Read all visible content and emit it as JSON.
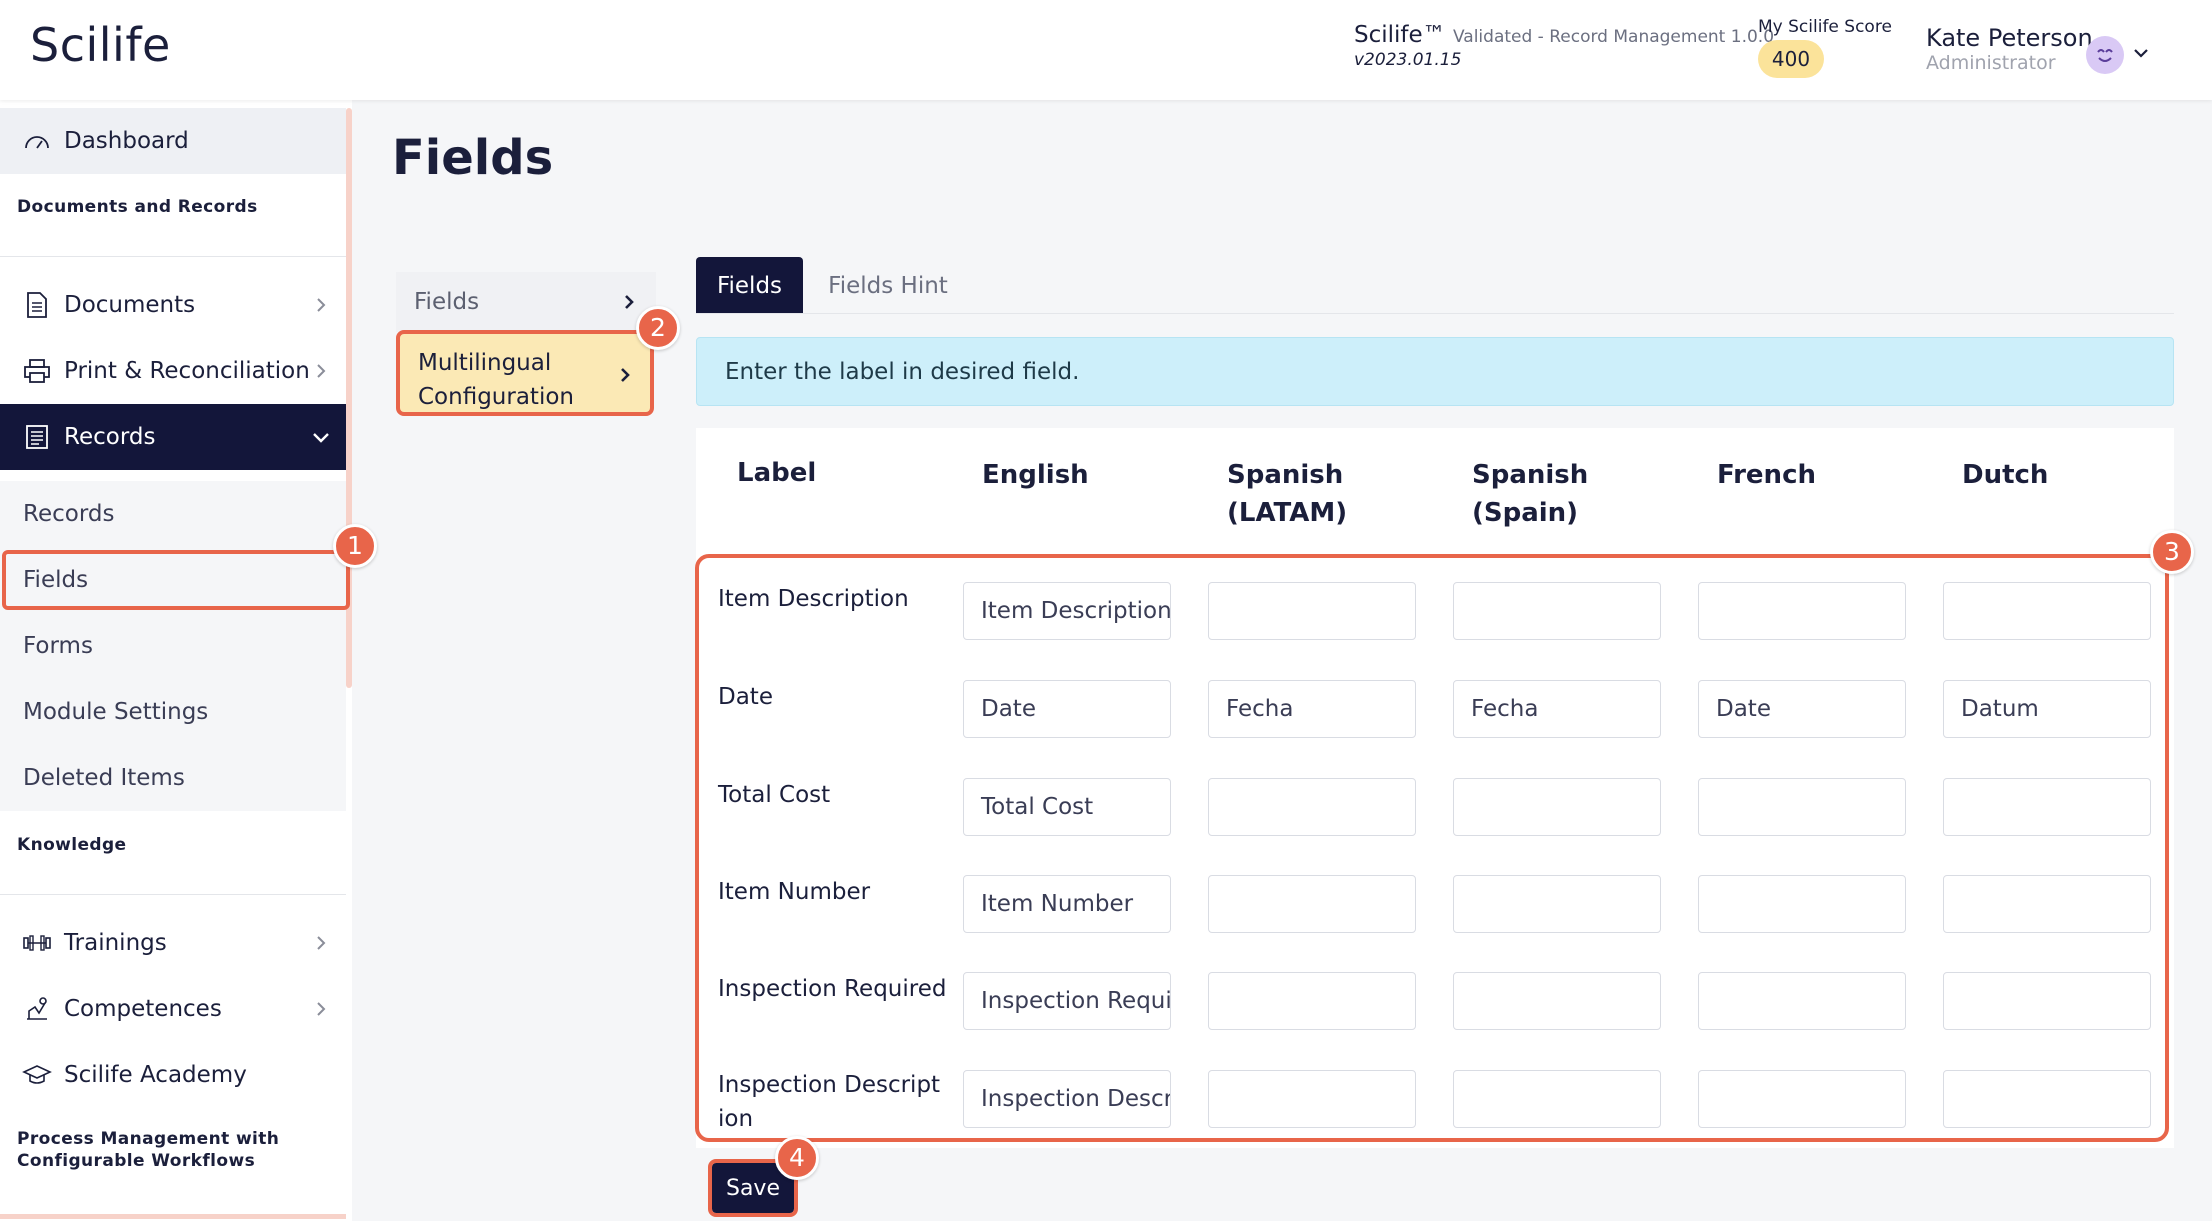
{
  "header": {
    "logo": "Scilife",
    "app_name": "Scilife™",
    "app_sub": "Validated - Record Management 1.0.0",
    "app_version": "v2023.01.15",
    "score_label": "My Scilife Score",
    "score_value": "400",
    "user_name": "Kate Peterson",
    "user_role": "Administrator"
  },
  "sidebar": {
    "dashboard": "Dashboard",
    "section_docs": "Documents and Records",
    "documents": "Documents",
    "print": "Print & Reconciliation",
    "records": "Records",
    "sub_items": [
      "Records",
      "Fields",
      "Forms",
      "Module Settings",
      "Deleted Items"
    ],
    "section_knowledge": "Knowledge",
    "trainings": "Trainings",
    "competences": "Competences",
    "academy": "Scilife Academy",
    "section_process_1": "Process Management with",
    "section_process_2": "Configurable Workflows"
  },
  "main": {
    "title": "Fields",
    "subnav": {
      "fields": "Fields",
      "multilingual_1": "Multilingual",
      "multilingual_2": "Configuration"
    },
    "tabs": {
      "fields": "Fields",
      "hint": "Fields Hint"
    },
    "info": "Enter the label in desired field.",
    "columns": {
      "label": "Label",
      "english": "English",
      "spanish_latam_1": "Spanish",
      "spanish_latam_2": "(LATAM)",
      "spanish_spain_1": "Spanish",
      "spanish_spain_2": "(Spain)",
      "french": "French",
      "dutch": "Dutch"
    },
    "rows": [
      {
        "label": "Item Description",
        "label2": "",
        "values": [
          "Item Description",
          "",
          "",
          "",
          ""
        ]
      },
      {
        "label": "Date",
        "label2": "",
        "values": [
          "Date",
          "Fecha",
          "Fecha",
          "Date",
          "Datum"
        ]
      },
      {
        "label": "Total Cost",
        "label2": "",
        "values": [
          "Total Cost",
          "",
          "",
          "",
          ""
        ]
      },
      {
        "label": "Item Number",
        "label2": "",
        "values": [
          "Item Number",
          "",
          "",
          "",
          ""
        ]
      },
      {
        "label": "Inspection Required",
        "label2": "",
        "values": [
          "Inspection Requi",
          "",
          "",
          "",
          ""
        ]
      },
      {
        "label": "Inspection Descript",
        "label2": "ion",
        "values": [
          "Inspection Descr",
          "",
          "",
          "",
          ""
        ]
      }
    ],
    "save": "Save"
  },
  "annotations": [
    "1",
    "2",
    "3",
    "4"
  ],
  "colors": {
    "accent": "#e8654a",
    "navy": "#13163a",
    "highlight": "#fbe9b5",
    "info_bg": "#cdeffa",
    "score_bg": "#fbe39a"
  },
  "icons": [
    "dashboard-gauge-icon",
    "document-icon",
    "printer-icon",
    "records-icon",
    "trainings-dumbbell-icon",
    "competences-icon",
    "academy-cap-icon",
    "chevron-right-icon",
    "chevron-down-icon",
    "avatar-smile-icon"
  ]
}
